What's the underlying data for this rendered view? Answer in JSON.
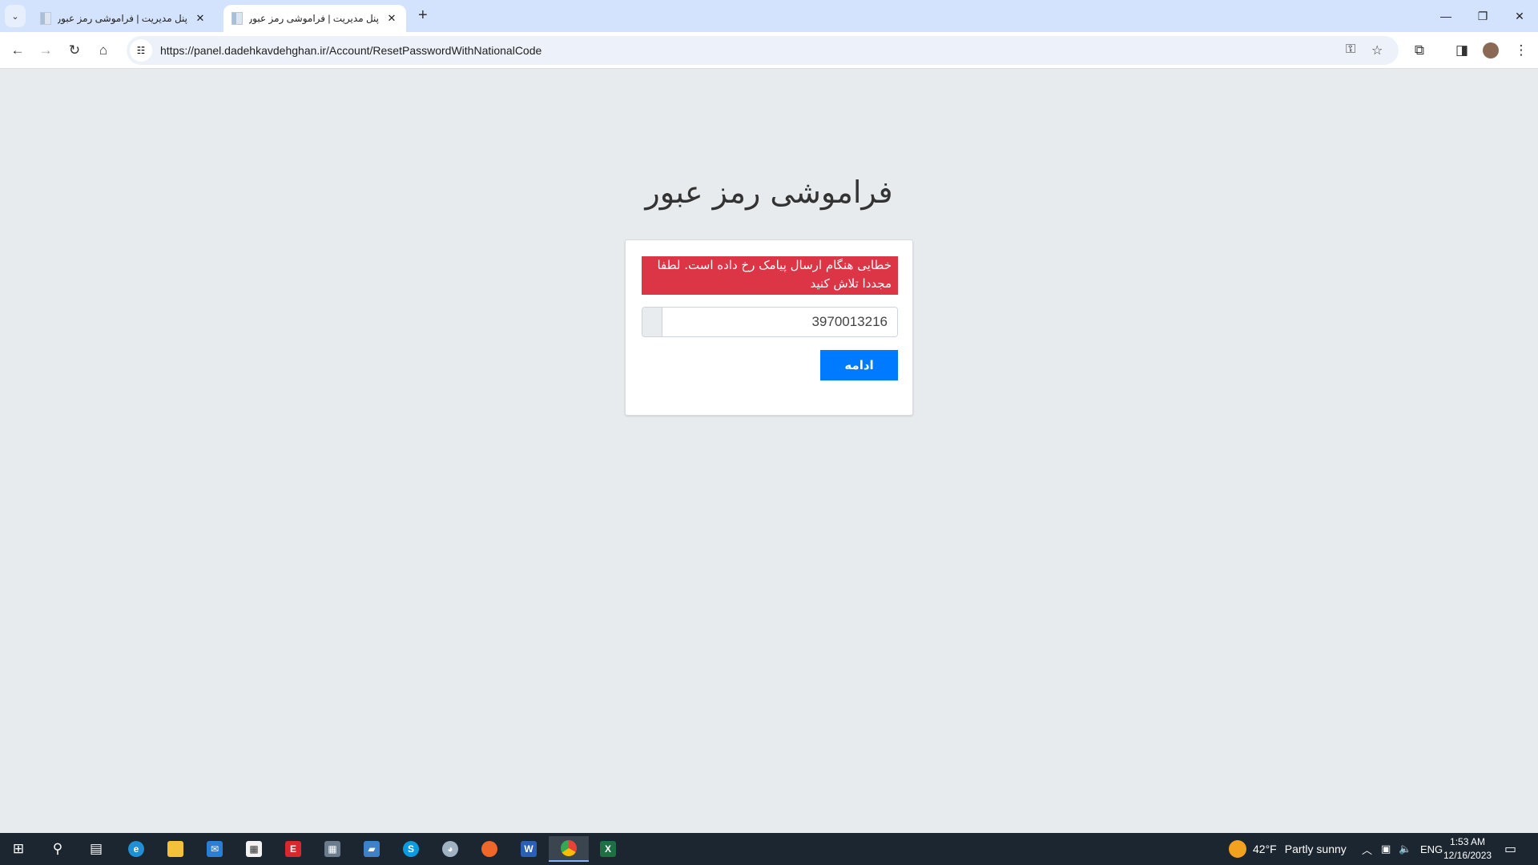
{
  "browser": {
    "tabs": [
      {
        "title": "پنل مدیریت | فراموشی رمز عبور",
        "active": false
      },
      {
        "title": "پنل مدیریت | فراموشی رمز عبور",
        "active": true
      }
    ],
    "url": "https://panel.dadehkavdehghan.ir/Account/ResetPasswordWithNationalCode"
  },
  "page": {
    "title": "فراموشی رمز عبور",
    "alert": "خطایی هنگام ارسال پیامک رخ داده است. لطفا مجددا تلاش کنید",
    "national_code_value": "3970013216",
    "submit_label": "ادامه",
    "colors": {
      "alert": "#dc3545",
      "primary": "#007bff"
    }
  },
  "taskbar": {
    "weather": {
      "temp": "42°F",
      "condition": "Partly sunny"
    },
    "language": "ENG",
    "time": "1:53 AM",
    "date": "12/16/2023"
  }
}
